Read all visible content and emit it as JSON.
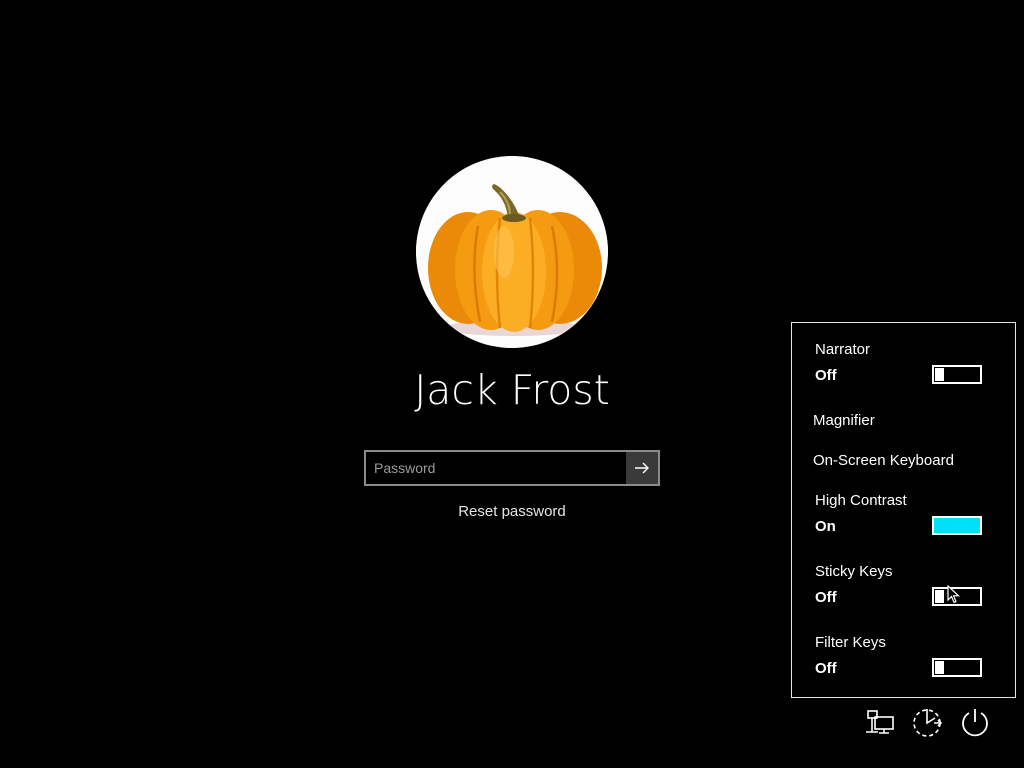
{
  "user": {
    "name": "Jack Frost",
    "avatar_icon": "pumpkin-avatar"
  },
  "password": {
    "placeholder": "Password",
    "value": "",
    "submit_icon": "arrow-right-icon"
  },
  "reset_password_label": "Reset password",
  "ease_of_access": {
    "items": [
      {
        "label": "Narrator",
        "state": "Off",
        "on": false
      },
      {
        "label": "Magnifier"
      },
      {
        "label": "On-Screen Keyboard"
      },
      {
        "label": "High Contrast",
        "state": "On",
        "on": true
      },
      {
        "label": "Sticky Keys",
        "state": "Off",
        "on": false
      },
      {
        "label": "Filter Keys",
        "state": "Off",
        "on": false
      }
    ]
  },
  "taskbar_icons": [
    "network-icon",
    "ease-of-access-icon",
    "power-icon"
  ],
  "colors": {
    "background": "#000000",
    "toggle_on": "#00e1f7",
    "pumpkin": "#f39a13"
  }
}
